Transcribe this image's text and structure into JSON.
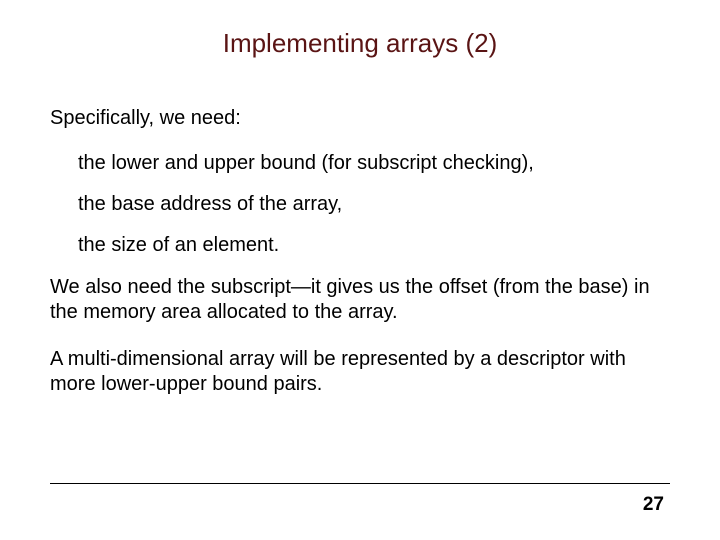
{
  "title": "Implementing arrays (2)",
  "intro": "Specifically, we need:",
  "bullets": [
    "the lower and upper bound (for subscript checking),",
    "the base address of the array,",
    "the size of an element."
  ],
  "paras": [
    "We also need the subscript—it gives us the offset (from the base) in the memory area allocated to the array.",
    "A multi-dimensional array will be represented by a descriptor with more lower-upper bound pairs."
  ],
  "page_number": "27"
}
